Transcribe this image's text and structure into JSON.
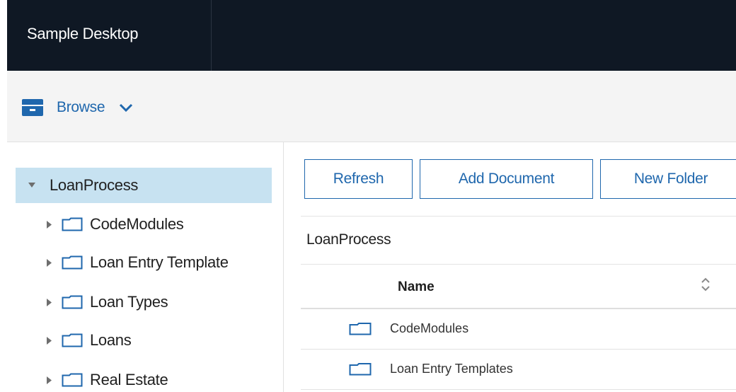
{
  "header": {
    "app_title": "Sample Desktop"
  },
  "feature_bar": {
    "feature_label": "Browse",
    "feature_icon": "browse-drawer-icon",
    "dropdown_icon": "chevron-down-icon"
  },
  "tree": {
    "root": {
      "label": "LoanProcess",
      "expanded": true,
      "selected": true
    },
    "children": [
      {
        "label": "CodeModules"
      },
      {
        "label": "Loan Entry Template"
      },
      {
        "label": "Loan Types"
      },
      {
        "label": "Loans"
      },
      {
        "label": "Real Estate"
      }
    ]
  },
  "toolbar": {
    "refresh_label": "Refresh",
    "add_document_label": "Add Document",
    "new_folder_label": "New Folder"
  },
  "breadcrumb": "LoanProcess",
  "table": {
    "columns": [
      "Name"
    ],
    "sort_icon": "sort-toggle-icon",
    "rows": [
      {
        "type": "folder",
        "name": "CodeModules"
      },
      {
        "type": "folder",
        "name": "Loan Entry Templates"
      }
    ]
  },
  "colors": {
    "header_bg": "#0f1824",
    "accent_blue": "#1f67ad",
    "selection_bg": "#c7e2f1",
    "feature_bar_bg": "#f4f4f4"
  }
}
